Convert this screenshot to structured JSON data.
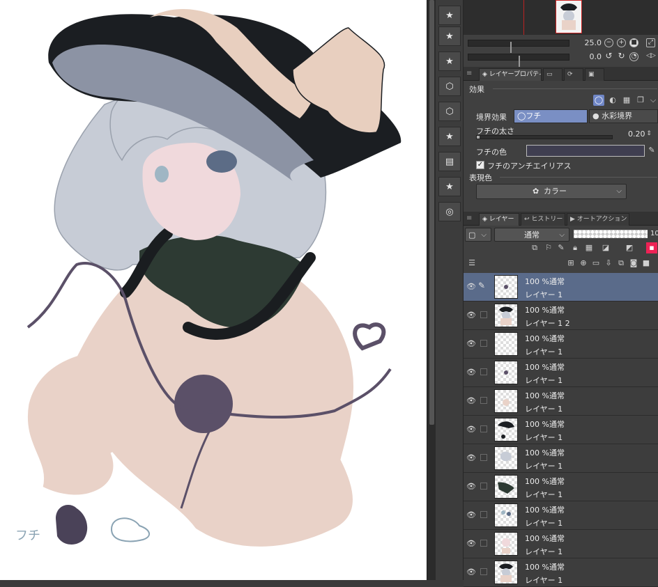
{
  "colors": {
    "panel_bg": "#404040",
    "selected_layer": "#5a6b8a",
    "border_color_swatch": "#3f3e50",
    "accent_blue": "#7a8fc4"
  },
  "navigator": {
    "zoom_value": "25.0",
    "rotate_value": "0.0"
  },
  "property_panel": {
    "tabs": [
      {
        "label": "レイヤープロパティ",
        "icon": "layer-property-icon"
      },
      {
        "label": "",
        "icon": "tool-property-icon"
      },
      {
        "label": "",
        "icon": "sub-tool-icon"
      },
      {
        "label": "",
        "icon": "image-icon"
      }
    ],
    "effect_title": "効果",
    "border_effect_label": "境界効果",
    "border_option_1": "フチ",
    "border_option_2": "水彩境界",
    "border_width_label": "フチの太さ",
    "border_width_value": "0.20",
    "border_color_label": "フチの色",
    "antialias_label": "フチのアンチエイリアス",
    "expression_color_label": "表現色",
    "expression_color_value": "カラー"
  },
  "layer_panel": {
    "tabs": [
      {
        "label": "レイヤー",
        "icon": "layers-icon"
      },
      {
        "label": "ヒストリー",
        "icon": "history-icon"
      },
      {
        "label": "オートアクション",
        "icon": "auto-action-icon"
      }
    ],
    "blend_mode": "通常",
    "opacity_value": "10",
    "layers": [
      {
        "mode": "100 %通常",
        "name": "レイヤー 1",
        "selected": true,
        "thumb": "dot"
      },
      {
        "mode": "100 %通常",
        "name": "レイヤー 1 2",
        "selected": false,
        "thumb": "figure"
      },
      {
        "mode": "100 %通常",
        "name": "レイヤー 1",
        "selected": false,
        "thumb": "empty"
      },
      {
        "mode": "100 %通常",
        "name": "レイヤー 1",
        "selected": false,
        "thumb": "dot"
      },
      {
        "mode": "100 %通常",
        "name": "レイヤー 1",
        "selected": false,
        "thumb": "beige"
      },
      {
        "mode": "100 %通常",
        "name": "レイヤー 1",
        "selected": false,
        "thumb": "hat"
      },
      {
        "mode": "100 %通常",
        "name": "レイヤー 1",
        "selected": false,
        "thumb": "hair"
      },
      {
        "mode": "100 %通常",
        "name": "レイヤー 1",
        "selected": false,
        "thumb": "collar"
      },
      {
        "mode": "100 %通常",
        "name": "レイヤー 1",
        "selected": false,
        "thumb": "eyes"
      },
      {
        "mode": "100 %通常",
        "name": "レイヤー 1",
        "selected": false,
        "thumb": "skin"
      },
      {
        "mode": "100 %通常",
        "name": "レイヤー 1",
        "selected": false,
        "thumb": "figure"
      }
    ]
  },
  "canvas": {
    "caption": "フチ"
  }
}
